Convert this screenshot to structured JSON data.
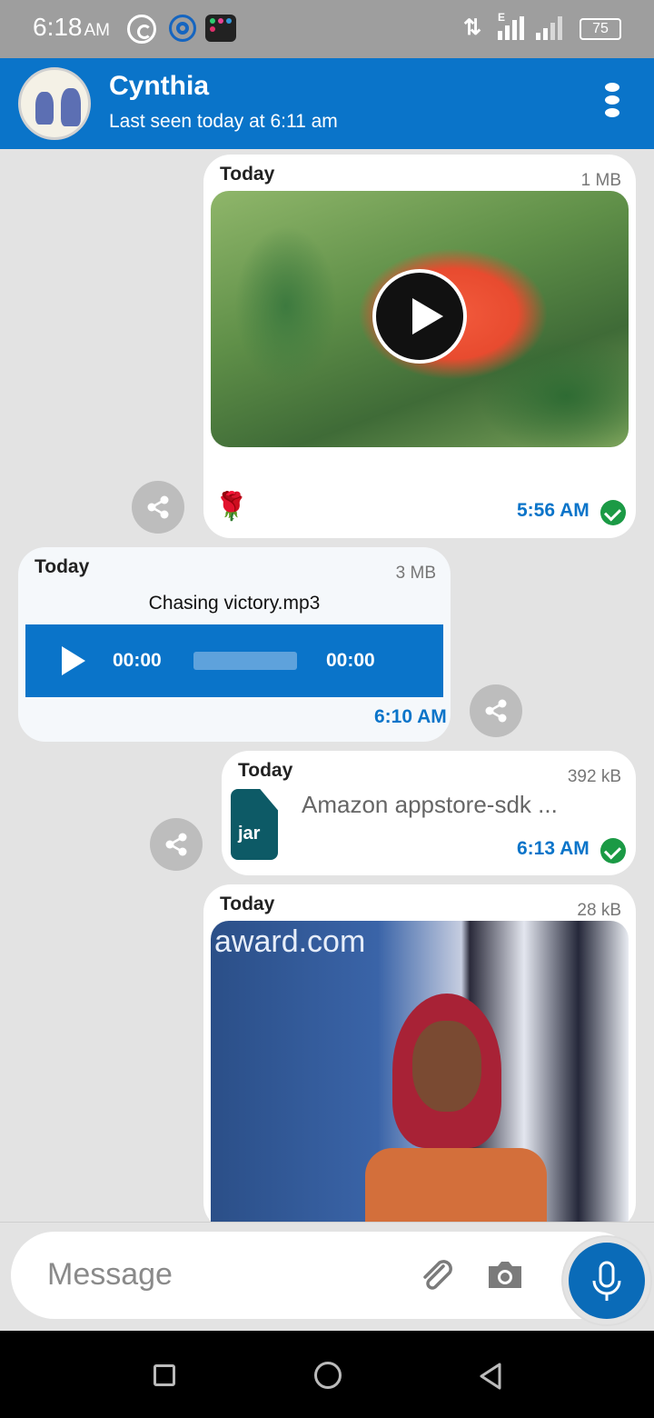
{
  "status_bar": {
    "time": "6:18",
    "ampm": "AM",
    "network": "E",
    "battery": "75"
  },
  "header": {
    "contact_name": "Cynthia",
    "last_seen": "Last seen today at 6:11 am"
  },
  "messages": [
    {
      "type": "video",
      "direction": "outgoing",
      "date": "Today",
      "size": "1 MB",
      "caption_emoji": "🌹",
      "time": "5:56 AM",
      "delivered": true
    },
    {
      "type": "audio",
      "direction": "incoming",
      "date": "Today",
      "size": "3 MB",
      "filename": "Chasing victory.mp3",
      "current_time": "00:00",
      "duration": "00:00",
      "time": "6:10 AM"
    },
    {
      "type": "file",
      "direction": "outgoing",
      "date": "Today",
      "size": "392 kB",
      "file_ext": "jar",
      "filename": "Amazon appstore-sdk ...",
      "time": "6:13 AM",
      "delivered": true
    },
    {
      "type": "image",
      "direction": "outgoing",
      "date": "Today",
      "size": "28 kB",
      "watermark": "award.com"
    }
  ],
  "input": {
    "placeholder": "Message"
  },
  "colors": {
    "primary": "#0a74c9",
    "background": "#e3e3e3",
    "delivered": "#1b9a45"
  }
}
